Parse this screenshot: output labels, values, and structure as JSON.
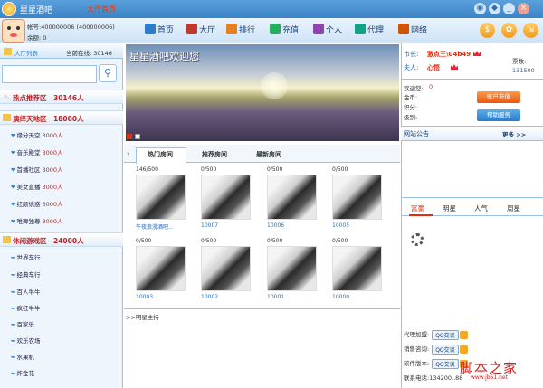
{
  "window": {
    "app_title": "星星酒吧",
    "lobby_title": "大厅首页",
    "min": "_",
    "close": "×"
  },
  "user": {
    "id_line": "帐号:400000006 (400000006)",
    "coins_line": "余额: 0"
  },
  "nav": [
    "首页",
    "大厅",
    "排行",
    "充值",
    "个人",
    "代理",
    "网络"
  ],
  "nav_colors": [
    "#2e7dc9",
    "#c0392b",
    "#e67e22",
    "#27ae60",
    "#8e44ad",
    "#16a085",
    "#d35400"
  ],
  "sidebar": {
    "title": "大厅列表",
    "online": "当前在线: 30146",
    "search_placeholder": "",
    "sections": [
      {
        "name": "热点推荐区",
        "count": "30146人",
        "items": []
      },
      {
        "name": "演绎天地区",
        "count": "18000人",
        "items": [
          {
            "name": "缘分天空",
            "count": "3000人"
          },
          {
            "name": "音乐殿堂",
            "count": "3000人"
          },
          {
            "name": "首播社区",
            "count": "3000人"
          },
          {
            "name": "美女直播",
            "count": "3000人"
          },
          {
            "name": "红颜诱惑",
            "count": "3000人"
          },
          {
            "name": "唯舞独尊",
            "count": "3000人"
          }
        ]
      },
      {
        "name": "休闲游戏区",
        "count": "24000人",
        "items": [
          {
            "name": "世界车行",
            "count": ""
          },
          {
            "name": "经典车行",
            "count": ""
          },
          {
            "name": "百人牛牛",
            "count": ""
          },
          {
            "name": "疯狂牛牛",
            "count": ""
          },
          {
            "name": "百家乐",
            "count": ""
          },
          {
            "name": "欢乐农场",
            "count": ""
          },
          {
            "name": "水果机",
            "count": ""
          },
          {
            "name": "炸金花",
            "count": ""
          }
        ]
      }
    ]
  },
  "banner": {
    "text": "星星酒吧欢迎您"
  },
  "tabs": [
    "热门房间",
    "推荐房间",
    "最新房间"
  ],
  "rooms": [
    {
      "count": "146/500",
      "name": "午夜浪漫酒吧..."
    },
    {
      "count": "0/500",
      "name": "10007"
    },
    {
      "count": "0/500",
      "name": "10006"
    },
    {
      "count": "0/500",
      "name": "10005"
    },
    {
      "count": "0/500",
      "name": "10003"
    },
    {
      "count": "0/500",
      "name": "10002"
    },
    {
      "count": "0/500",
      "name": "10001"
    },
    {
      "count": "0/500",
      "name": "10000"
    }
  ],
  "stars_header": ">>明星主持",
  "right": {
    "mayor_label": "市长:",
    "mayor_name": "激点王\\u4b49",
    "wife_label": "夫人:",
    "wife_name": "心悟",
    "tickets_label": "票数:",
    "tickets_value": "131500",
    "welcome": "欢迎您:",
    "welcome_value": "0",
    "gold": "金币:",
    "points": "积分:",
    "level": "级别:",
    "recharge_btn": "账户充值",
    "help_btn": "帮助服务",
    "notice_title": "网站公告",
    "more": "更多 >>",
    "rank_tabs": [
      "富豪",
      "明星",
      "人气",
      "周星"
    ],
    "contacts": [
      {
        "label": "代理加盟:",
        "btn": "QQ交谈"
      },
      {
        "label": "销售咨询:",
        "btn": "QQ交谈"
      },
      {
        "label": "软件版本:",
        "btn": "QQ交谈"
      },
      {
        "label": "联系电话:",
        "value": "134200..88"
      }
    ]
  },
  "watermark": {
    "text": "脚本之家",
    "url": "www.jb51.net"
  }
}
